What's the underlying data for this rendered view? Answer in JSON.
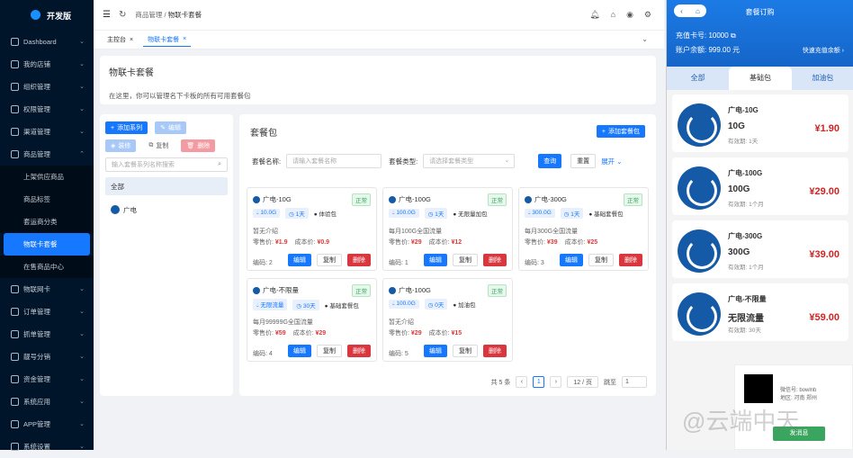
{
  "brand": "开发版",
  "sidebar": [
    {
      "label": "Dashboard",
      "chev": "⌄"
    },
    {
      "label": "我的店铺",
      "chev": "⌄"
    },
    {
      "label": "组织管理",
      "chev": "⌄"
    },
    {
      "label": "权限管理",
      "chev": "⌄"
    },
    {
      "label": "渠道管理",
      "chev": "⌄"
    },
    {
      "label": "商品管理",
      "chev": "⌃"
    },
    {
      "label": "上架供应商品"
    },
    {
      "label": "商品标签"
    },
    {
      "label": "套运商分类"
    },
    {
      "label": "物联卡套餐"
    },
    {
      "label": "在售商品中心"
    },
    {
      "label": "物联网卡",
      "chev": "⌄"
    },
    {
      "label": "订单管理",
      "chev": "⌄"
    },
    {
      "label": "抓单管理",
      "chev": "⌄"
    },
    {
      "label": "靓号分销",
      "chev": "⌄"
    },
    {
      "label": "资金管理",
      "chev": "⌄"
    },
    {
      "label": "系统应用",
      "chev": "⌄"
    },
    {
      "label": "APP管理",
      "chev": "⌄"
    },
    {
      "label": "系统设置",
      "chev": "⌄"
    }
  ],
  "breadcrumb": {
    "parent": "商品管理",
    "sep": "/",
    "current": "物联卡套餐"
  },
  "tabs": [
    {
      "label": "主控台"
    },
    {
      "label": "物联卡套餐"
    }
  ],
  "header": {
    "title": "物联卡套餐",
    "desc": "在这里，你可以管理名下卡板的所有可用套餐包"
  },
  "left": {
    "add": "添加系列",
    "edit": "编辑",
    "fill": "装修",
    "copy": "复制",
    "del": "删除",
    "search_ph": "输入套餐系列名称搜索",
    "all": "全部",
    "item": "广电"
  },
  "main": {
    "title": "套餐包",
    "add": "添加套餐包",
    "name_label": "套餐名称:",
    "name_ph": "请输入套餐名称",
    "type_label": "套餐类型:",
    "type_ph": "请选择套餐类型",
    "query": "查询",
    "reset": "重置",
    "expand": "展开"
  },
  "cards": [
    {
      "name": "广电-10G",
      "status": "正常",
      "t1": "10.0G",
      "t2": "1天",
      "t3": "体验包",
      "desc": "暂无介绍",
      "sell_l": "零售价:",
      "sell": "¥1.9",
      "cost_l": "成本价:",
      "cost": "¥0.9",
      "code": "编码: 2"
    },
    {
      "name": "广电-100G",
      "status": "正常",
      "t1": "100.0G",
      "t2": "1天",
      "t3": "无限量加包",
      "desc": "每月100G全国流量",
      "sell_l": "零售价:",
      "sell": "¥29",
      "cost_l": "成本价:",
      "cost": "¥12",
      "code": "编码: 1"
    },
    {
      "name": "广电-300G",
      "status": "正常",
      "t1": "300.0G",
      "t2": "1天",
      "t3": "基础套餐包",
      "desc": "每月300G全国流量",
      "sell_l": "零售价:",
      "sell": "¥39",
      "cost_l": "成本价:",
      "cost": "¥25",
      "code": "编码: 3"
    },
    {
      "name": "广电-不限量",
      "status": "正常",
      "t1": "无限流量",
      "t2": "30天",
      "t3": "基础套餐包",
      "desc": "每月99999G全国流量",
      "sell_l": "零售价:",
      "sell": "¥59",
      "cost_l": "成本价:",
      "cost": "¥29",
      "code": "编码: 4"
    },
    {
      "name": "广电-100G",
      "status": "正常",
      "t1": "100.0G",
      "t2": "0天",
      "t3": "加油包",
      "desc": "暂无介绍",
      "sell_l": "零售价:",
      "sell": "¥29",
      "cost_l": "成本价:",
      "cost": "¥15",
      "code": "编码: 5"
    }
  ],
  "card_btns": {
    "edit": "编辑",
    "copy": "复制",
    "del": "删除"
  },
  "pager": {
    "total": "共 5 条",
    "page": "1",
    "size": "12 / 页",
    "jump": "跳至",
    "jump_val": "1",
    "prev": "‹",
    "next": "›"
  },
  "phone": {
    "title": "套餐订购",
    "card": "充值卡号: 10000",
    "balance": "账户余额: 999.00 元",
    "fast": "快速充值余额 ›",
    "tabs": [
      "全部",
      "基础包",
      "加油包"
    ],
    "items": [
      {
        "name": "广电-10G",
        "big": "10G",
        "valid": "有效期: 1天",
        "price": "¥1.90"
      },
      {
        "name": "广电-100G",
        "big": "100G",
        "valid": "有效期: 1个月",
        "price": "¥29.00"
      },
      {
        "name": "广电-300G",
        "big": "300G",
        "valid": "有效期: 1个月",
        "price": "¥39.00"
      },
      {
        "name": "广电-不限量",
        "big": "无限流量",
        "valid": "有效期: 30天",
        "price": "¥59.00"
      }
    ]
  },
  "qr": {
    "wx": "微信号: bowlnb",
    "area": "地区: 河南 郑州",
    "go": "发消息"
  },
  "watermark": "@云端中天"
}
